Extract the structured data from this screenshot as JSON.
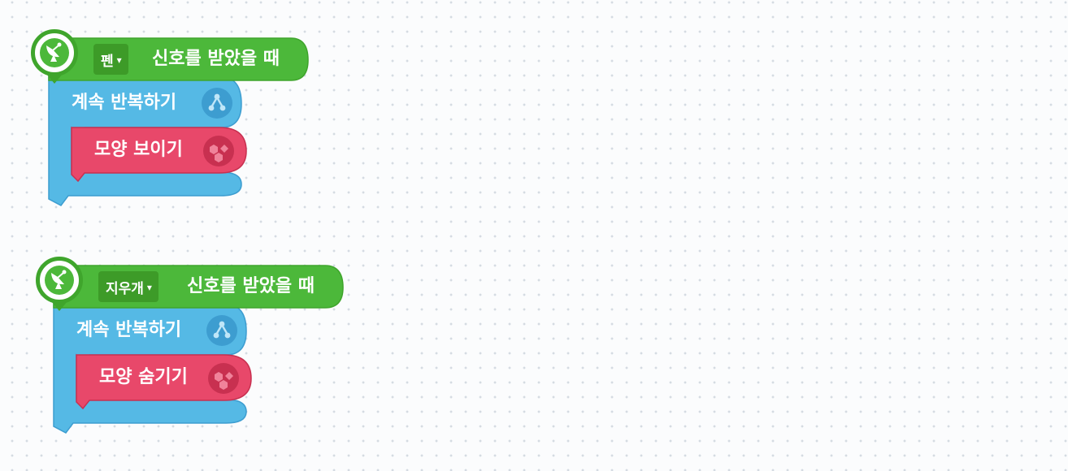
{
  "colors": {
    "event_green": "#4cb83a",
    "event_green_dark": "#3fa52c",
    "flow_blue": "#55b9e5",
    "flow_blue_dark": "#3d9dd0",
    "looks_red": "#e8486a",
    "looks_red_dark": "#c83050",
    "background": "#fbfcfd",
    "grid_dot": "#d5dbe2"
  },
  "scripts": [
    {
      "hat": {
        "icon": "satellite-dish-icon",
        "dropdown_value": "펜",
        "dropdown_arrow": "▾",
        "label": "신호를 받았을 때"
      },
      "loop": {
        "label": "계속 반복하기",
        "icon": "flow-branch-icon"
      },
      "inner": {
        "label": "모양 보이기",
        "icon": "shapes-icon"
      }
    },
    {
      "hat": {
        "icon": "satellite-dish-icon",
        "dropdown_value": "지우개",
        "dropdown_arrow": "▾",
        "label": "신호를 받았을 때"
      },
      "loop": {
        "label": "계속 반복하기",
        "icon": "flow-branch-icon"
      },
      "inner": {
        "label": "모양 숨기기",
        "icon": "shapes-icon"
      }
    }
  ]
}
